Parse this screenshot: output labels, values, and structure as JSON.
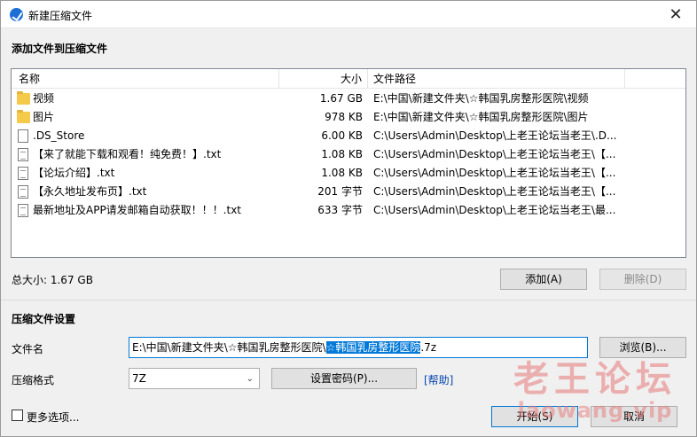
{
  "window": {
    "title": "新建压缩文件",
    "close_glyph": "✕"
  },
  "add_section": {
    "heading": "添加文件到压缩文件"
  },
  "file_list": {
    "columns": [
      "名称",
      "大小",
      "文件路径"
    ],
    "rows": [
      {
        "icon": "folder-icon",
        "name": "视频",
        "size": "1.67 GB",
        "path": "E:\\中国\\新建文件夹\\☆韩国乳房整形医院\\视频"
      },
      {
        "icon": "folder-icon",
        "name": "图片",
        "size": "978 KB",
        "path": "E:\\中国\\新建文件夹\\☆韩国乳房整形医院\\图片"
      },
      {
        "icon": "file-icon",
        "name": ".DS_Store",
        "size": "6.00 KB",
        "path": "C:\\Users\\Admin\\Desktop\\上老王论坛当老王\\.D..."
      },
      {
        "icon": "text-file-icon",
        "name": "【来了就能下载和观看！纯免费！】.txt",
        "size": "1.08 KB",
        "path": "C:\\Users\\Admin\\Desktop\\上老王论坛当老王\\【..."
      },
      {
        "icon": "text-file-icon",
        "name": "【论坛介绍】.txt",
        "size": "1.08 KB",
        "path": "C:\\Users\\Admin\\Desktop\\上老王论坛当老王\\【..."
      },
      {
        "icon": "text-file-icon",
        "name": "【永久地址发布页】.txt",
        "size": "201 字节",
        "path": "C:\\Users\\Admin\\Desktop\\上老王论坛当老王\\【..."
      },
      {
        "icon": "text-file-icon",
        "name": "最新地址及APP请发邮箱自动获取！！！.txt",
        "size": "633 字节",
        "path": "C:\\Users\\Admin\\Desktop\\上老王论坛当老王\\最..."
      }
    ]
  },
  "summary": {
    "total_size": "总大小: 1.67 GB"
  },
  "buttons": {
    "add": "添加(A)",
    "delete": "删除(D)",
    "browse": "浏览(B)...",
    "set_password": "设置密码(P)...",
    "help": "[帮助]",
    "start": "开始(S)",
    "cancel": "取消"
  },
  "settings": {
    "heading": "压缩文件设置",
    "filename_label": "文件名",
    "filename_prefix": "E:\\中国\\新建文件夹\\☆韩国乳房整形医院\\",
    "filename_selected": "☆韩国乳房整形医院",
    "filename_suffix": ".7z",
    "format_label": "压缩格式",
    "format_value": "7Z"
  },
  "more_options": {
    "label": "更多选项..."
  },
  "watermark": {
    "main": "老王论坛",
    "sub": "laowang.vip"
  },
  "colors": {
    "selection": "#0078d7",
    "link": "#0645ad",
    "folder": "#f5c94a"
  }
}
